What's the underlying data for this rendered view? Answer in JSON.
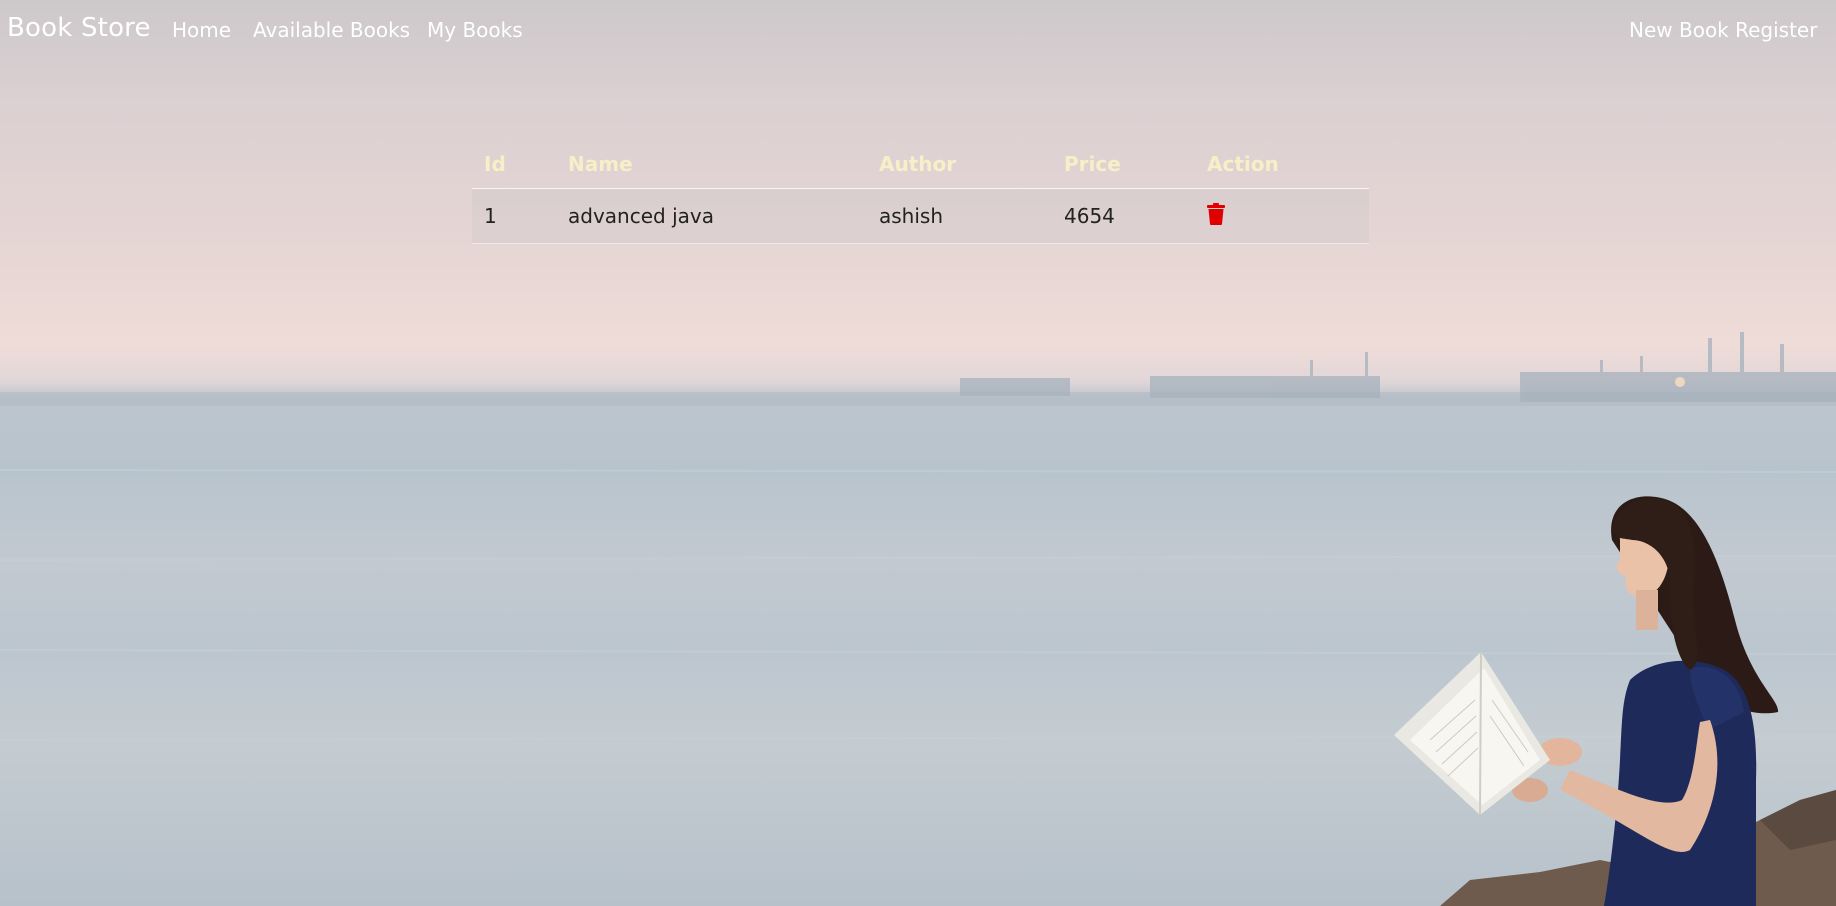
{
  "navbar": {
    "brand": "Book Store",
    "links": [
      "Home",
      "Available Books",
      "My Books"
    ],
    "register_label": "New Book Register"
  },
  "table": {
    "headers": [
      "Id",
      "Name",
      "Author",
      "Price",
      "Action"
    ],
    "rows": [
      {
        "id": "1",
        "name": "advanced java",
        "author": "ashish",
        "price": "4654",
        "action_icon": "trash-icon"
      }
    ]
  },
  "colors": {
    "header_text": "#f6efc8",
    "delete_icon": "#e00000",
    "nav_text": "#ffffff"
  },
  "icons": {
    "delete": "trash-icon"
  }
}
